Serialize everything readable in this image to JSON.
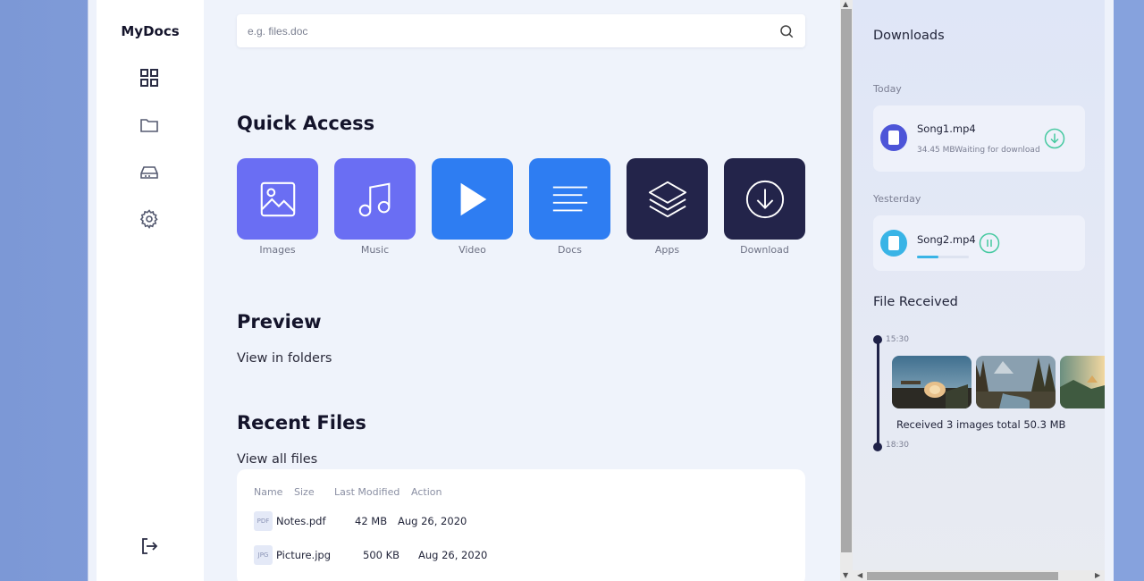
{
  "app": {
    "logo": "MyDocs"
  },
  "sidebar": {
    "items": [
      {
        "icon": "grid-icon"
      },
      {
        "icon": "folder-icon"
      },
      {
        "icon": "drive-icon"
      },
      {
        "icon": "gear-icon"
      }
    ],
    "logout_icon": "logout-icon"
  },
  "search": {
    "placeholder": "e.g. files.doc",
    "icon": "search-icon"
  },
  "quick_access": {
    "title": "Quick Access",
    "items": [
      {
        "label": "Images",
        "color": "#6a6ef3",
        "icon": "image-icon"
      },
      {
        "label": "Music",
        "color": "#6a6ef3",
        "icon": "music-icon"
      },
      {
        "label": "Video",
        "color": "#2e7df2",
        "icon": "play-icon"
      },
      {
        "label": "Docs",
        "color": "#2e7df2",
        "icon": "lines-icon"
      },
      {
        "label": "Apps",
        "color": "#23244a",
        "icon": "layers-icon"
      },
      {
        "label": "Download",
        "color": "#23244a",
        "icon": "download-icon"
      }
    ]
  },
  "preview": {
    "title": "Preview",
    "link": "View in folders"
  },
  "recent": {
    "title": "Recent Files",
    "link": "View all files",
    "columns": [
      "Name",
      "Size",
      "Last Modified",
      "Action"
    ],
    "rows": [
      {
        "badge": "PDF",
        "name": "Notes.pdf",
        "size": "42 MB",
        "modified": "Aug 26, 2020"
      },
      {
        "badge": "JPG",
        "name": "Picture.jpg",
        "size": "500 KB",
        "modified": "Aug 26, 2020"
      }
    ]
  },
  "downloads": {
    "title": "Downloads",
    "today_label": "Today",
    "yesterday_label": "Yesterday",
    "today": {
      "name": "Song1.mp4",
      "size": "34.45 MB",
      "status": "Waiting for download",
      "color": "#4d55d8",
      "action_icon": "download-circle-icon"
    },
    "yesterday": {
      "name": "Song2.mp4",
      "progress": 0.42,
      "color": "#39b4e6",
      "action_icon": "pause-icon"
    }
  },
  "file_received": {
    "title": "File Received",
    "start_time": "15:30",
    "end_time": "18:30",
    "summary": "Received 3 images total 50.3 MB"
  }
}
